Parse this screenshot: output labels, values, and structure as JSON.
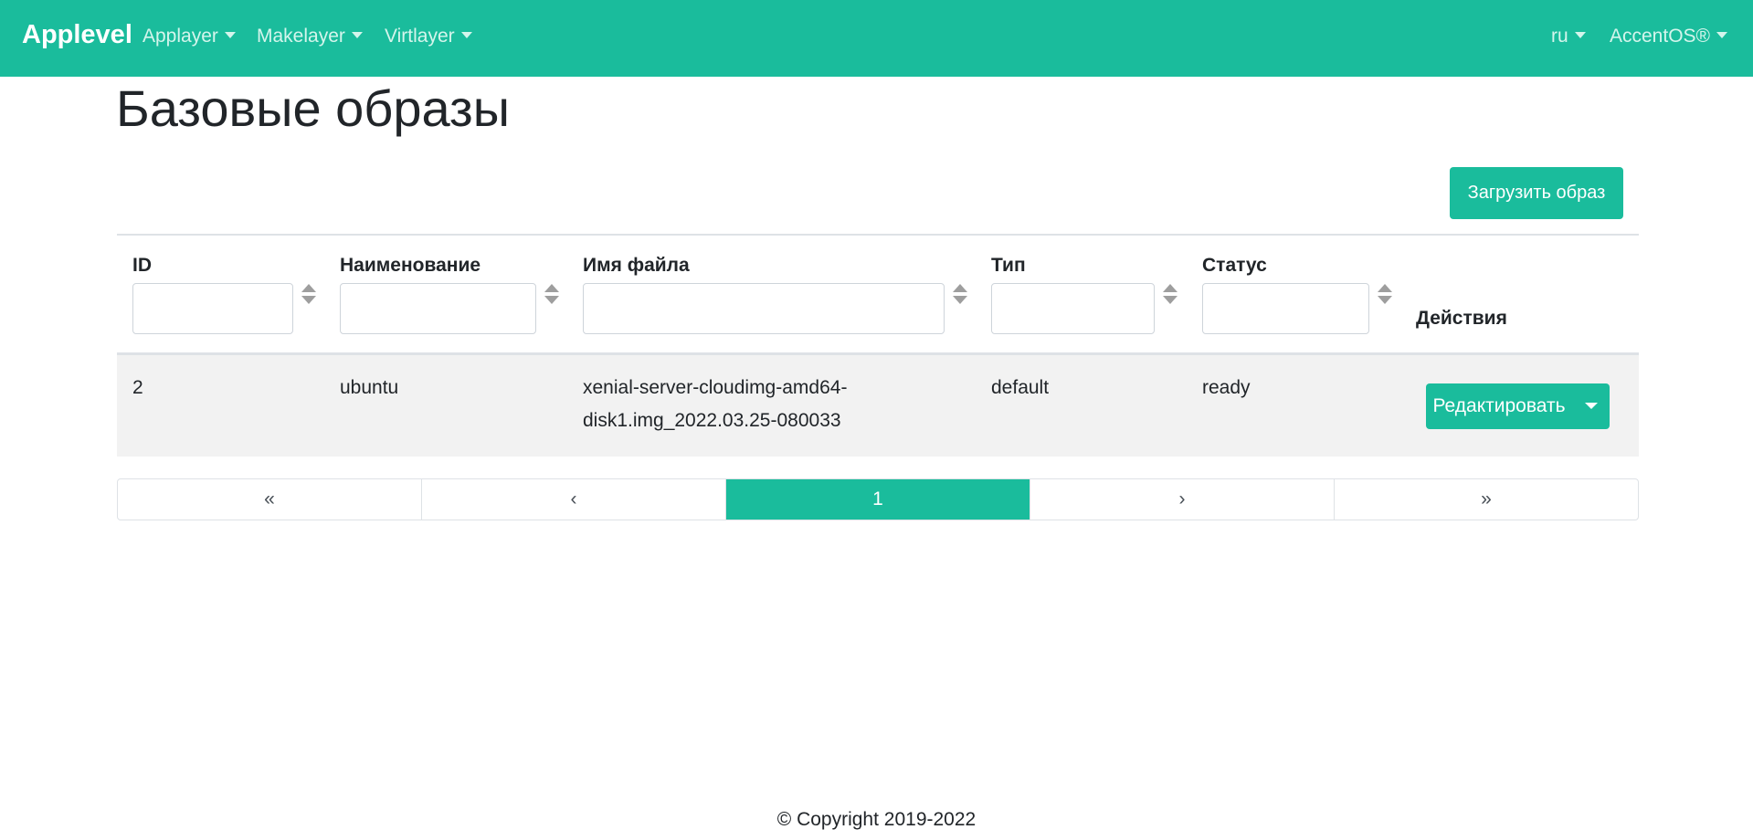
{
  "navbar": {
    "brand": "Applevel",
    "menus": [
      {
        "label": "Applayer"
      },
      {
        "label": "Makelayer"
      },
      {
        "label": "Virtlayer"
      }
    ],
    "language": "ru",
    "account": "AccentOS®",
    "color": "#1abc9c"
  },
  "page": {
    "title": "Базовые образы",
    "upload_button": "Загрузить образ"
  },
  "table": {
    "columns": [
      {
        "label": "ID"
      },
      {
        "label": "Наименование"
      },
      {
        "label": "Имя файла"
      },
      {
        "label": "Тип"
      },
      {
        "label": "Статус"
      },
      {
        "label": "Действия"
      }
    ],
    "rows": [
      {
        "id": "2",
        "name": "ubuntu",
        "filename_line1": "xenial-server-cloudimg-amd64-",
        "filename_line2": "disk1.img_2022.03.25-080033",
        "type": "default",
        "status": "ready",
        "action": "Редактировать"
      }
    ]
  },
  "pagination": {
    "first": "«",
    "prev": "‹",
    "current": "1",
    "next": "›",
    "last": "»"
  },
  "footer": {
    "copyright": "© Copyright 2019-2022"
  }
}
